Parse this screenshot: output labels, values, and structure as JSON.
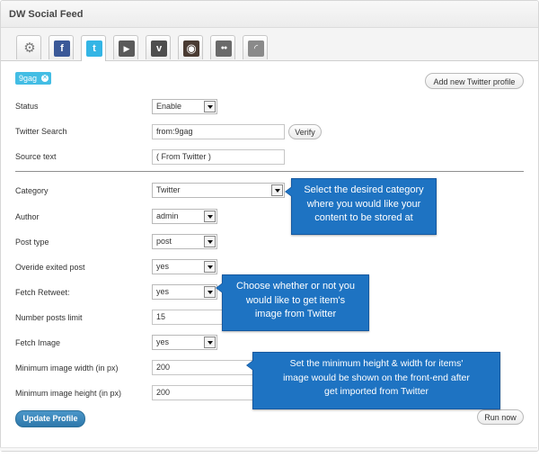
{
  "panel": {
    "title": "DW Social Feed"
  },
  "tabs": [
    {
      "name": "settings-icon",
      "label": "",
      "color": "#7b7b7b",
      "glyph": "⚙"
    },
    {
      "name": "facebook-icon",
      "label": "",
      "color": "#3b5998",
      "glyph": "f"
    },
    {
      "name": "twitter-icon",
      "label": "",
      "color": "#33b5e5",
      "glyph": "t"
    },
    {
      "name": "youtube-icon",
      "label": "",
      "color": "#5a5a5a",
      "glyph": "▶"
    },
    {
      "name": "vimeo-icon",
      "label": "",
      "color": "#4e4e4e",
      "glyph": "v"
    },
    {
      "name": "instagram-icon",
      "label": "",
      "color": "#4a3b32",
      "glyph": "◉"
    },
    {
      "name": "flickr-icon",
      "label": "",
      "color": "#6a6a6a",
      "glyph": "●●"
    },
    {
      "name": "rss-icon",
      "label": "",
      "color": "#8a8a8a",
      "glyph": "◜"
    }
  ],
  "profile_chip": {
    "label": "9gag"
  },
  "buttons": {
    "add_profile": "Add new Twitter profile",
    "verify": "Verify",
    "update": "Update Profile",
    "run_now": "Run now"
  },
  "fields": {
    "status": {
      "label": "Status",
      "value": "Enable"
    },
    "twitter_search": {
      "label": "Twitter Search",
      "value": "from:9gag"
    },
    "source_text": {
      "label": "Source text",
      "value": "( From Twitter )"
    },
    "category": {
      "label": "Category",
      "value": "Twitter"
    },
    "author": {
      "label": "Author",
      "value": "admin"
    },
    "post_type": {
      "label": "Post type",
      "value": "post"
    },
    "override": {
      "label": "Overide exited post",
      "value": "yes"
    },
    "fetch_retweet": {
      "label": "Fetch Retweet:",
      "value": "yes"
    },
    "number_limit": {
      "label": "Number posts limit",
      "value": "15"
    },
    "fetch_image": {
      "label": "Fetch Image",
      "value": "yes"
    },
    "min_width": {
      "label": "Minimum image width (in px)",
      "value": "200"
    },
    "min_height": {
      "label": "Minimum image height (in px)",
      "value": "200"
    }
  },
  "tooltips": {
    "category": [
      "Select the desired category",
      "where you would like your",
      "content to be stored at"
    ],
    "retweet": [
      "Choose whether or not you",
      "would like to get item's",
      "image from Twitter"
    ],
    "image_size": [
      "Set the minimum height & width for items'",
      "image would be shown on the front-end after",
      "get imported from Twitter"
    ]
  },
  "colors": {
    "accent": "#43bde4",
    "tooltip": "#1e73c2",
    "primary_button": "#2d78ab"
  }
}
